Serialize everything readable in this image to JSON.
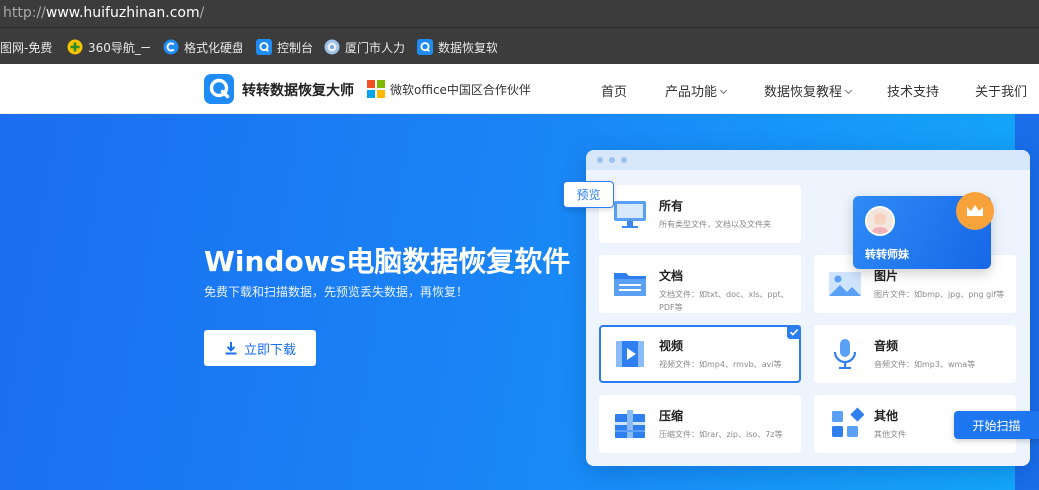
{
  "browser": {
    "url_prefix": "http://",
    "url_domain": "www.huifuzhinan.com",
    "url_suffix": "/",
    "bookmarks": [
      {
        "label": "图网-免费",
        "icon": "none"
      },
      {
        "label": "360导航_一",
        "icon": "360-icon"
      },
      {
        "label": "格式化硬盘",
        "icon": "c-logo-icon"
      },
      {
        "label": "控制台",
        "icon": "q-logo-icon"
      },
      {
        "label": "厦门市人力",
        "icon": "emblem-icon"
      },
      {
        "label": "数据恢复软",
        "icon": "q-logo-icon"
      }
    ]
  },
  "header": {
    "brand": "转转数据恢复大师",
    "partner": "微软office中国区合作伙伴",
    "nav": [
      "首页",
      "产品功能",
      "数据恢复教程",
      "技术支持",
      "关于我们"
    ]
  },
  "hero": {
    "title": "Windows电脑数据恢复软件",
    "subtitle": "免费下载和扫描数据，先预览丢失数据，再恢复！",
    "download_label": "立即下载"
  },
  "app_mock": {
    "preview_label": "预览",
    "user_name": "转转师妹",
    "scan_label": "开始扫描",
    "categories": [
      {
        "title": "所有",
        "desc": "所有类型文件，文档以及文件夹",
        "icon": "monitor-icon"
      },
      {
        "title": "文档",
        "desc": "文档文件：如txt、doc、xls、ppt、PDF等",
        "icon": "folder-icon"
      },
      {
        "title": "图片",
        "desc": "图片文件：如bmp、jpg、png gif等",
        "icon": "image-icon"
      },
      {
        "title": "视频",
        "desc": "视频文件：如mp4、rmvb、avi等",
        "icon": "video-icon",
        "selected": true
      },
      {
        "title": "音频",
        "desc": "音频文件：如mp3、wma等",
        "icon": "microphone-icon"
      },
      {
        "title": "压缩",
        "desc": "压缩文件：如rar、zip、iso、7z等",
        "icon": "archive-icon"
      },
      {
        "title": "其他",
        "desc": "其他文件",
        "icon": "other-files-icon"
      }
    ]
  }
}
